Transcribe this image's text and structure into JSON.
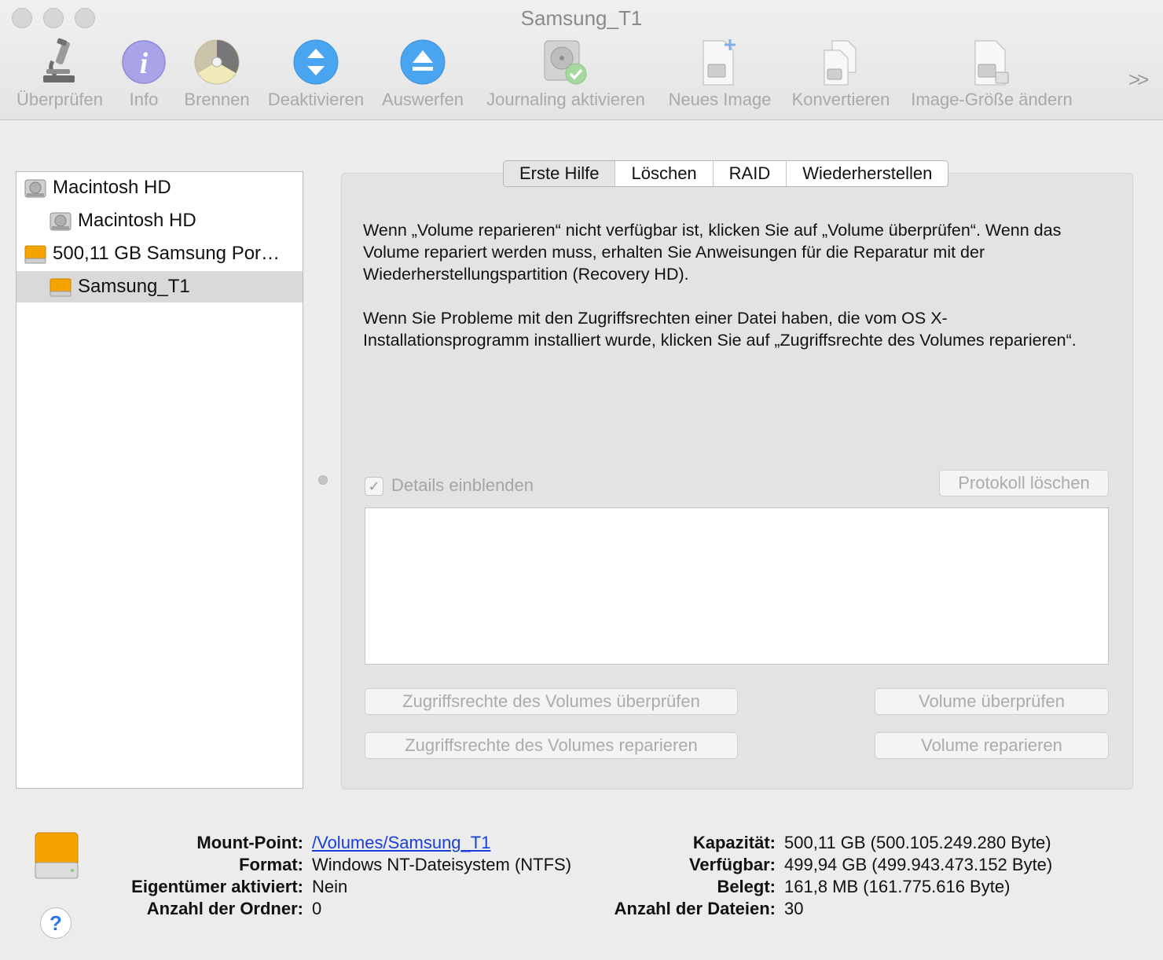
{
  "window": {
    "title": "Samsung_T1"
  },
  "toolbar": {
    "items": [
      {
        "label": "Überprüfen",
        "icon": "microscope-icon"
      },
      {
        "label": "Info",
        "icon": "info-icon"
      },
      {
        "label": "Brennen",
        "icon": "burn-disc-icon"
      },
      {
        "label": "Deaktivieren",
        "icon": "unmount-icon"
      },
      {
        "label": "Auswerfen",
        "icon": "eject-icon"
      },
      {
        "label": "Journaling aktivieren",
        "icon": "journaling-disk-icon"
      },
      {
        "label": "Neues Image",
        "icon": "new-image-icon"
      },
      {
        "label": "Konvertieren",
        "icon": "convert-icon"
      },
      {
        "label": "Image-Größe ändern",
        "icon": "resize-image-icon"
      }
    ],
    "overflow": ">>"
  },
  "sidebar": {
    "items": [
      {
        "label": "Macintosh HD",
        "icon": "internal-disk-icon"
      },
      {
        "label": "Macintosh HD",
        "icon": "internal-volume-icon"
      },
      {
        "label": "500,11 GB Samsung Por…",
        "icon": "external-disk-icon"
      },
      {
        "label": "Samsung_T1",
        "icon": "external-volume-icon",
        "selected": true
      }
    ]
  },
  "tabs": [
    "Erste Hilfe",
    "Löschen",
    "RAID",
    "Wiederherstellen"
  ],
  "first_aid": {
    "para1": "Wenn „Volume reparieren“ nicht verfügbar ist, klicken Sie auf „Volume überprüfen“. Wenn das Volume repariert werden muss, erhalten Sie Anweisungen für die Reparatur mit der Wiederherstellungspartition (Recovery HD).",
    "para2": "Wenn Sie Probleme mit den Zugriffsrechten einer Datei haben, die vom OS X-Installationsprogramm installiert wurde, klicken Sie auf „Zugriffsrechte des Volumes reparieren“.",
    "details_label": "Details einblenden",
    "details_checked": true,
    "clear_log": "Protokoll löschen",
    "verify_permissions": "Zugriffsrechte des Volumes überprüfen",
    "repair_permissions": "Zugriffsrechte des Volumes reparieren",
    "verify_volume": "Volume überprüfen",
    "repair_volume": "Volume reparieren"
  },
  "info": {
    "mount_point_label": "Mount-Point:",
    "mount_point": "/Volumes/Samsung_T1",
    "format_label": "Format:",
    "format": "Windows NT-Dateisystem (NTFS)",
    "owners_label": "Eigentümer aktiviert:",
    "owners": "Nein",
    "folders_label": "Anzahl der Ordner:",
    "folders": "0",
    "capacity_label": "Kapazität:",
    "capacity": "500,11 GB (500.105.249.280 Byte)",
    "available_label": "Verfügbar:",
    "available": "499,94 GB (499.943.473.152 Byte)",
    "used_label": "Belegt:",
    "used": "161,8 MB (161.775.616 Byte)",
    "files_label": "Anzahl der Dateien:",
    "files": "30"
  },
  "help": "?",
  "colors": {
    "accent_blue": "#4aa5f0",
    "drive_orange": "#f5a300",
    "link": "#1a3edb"
  }
}
